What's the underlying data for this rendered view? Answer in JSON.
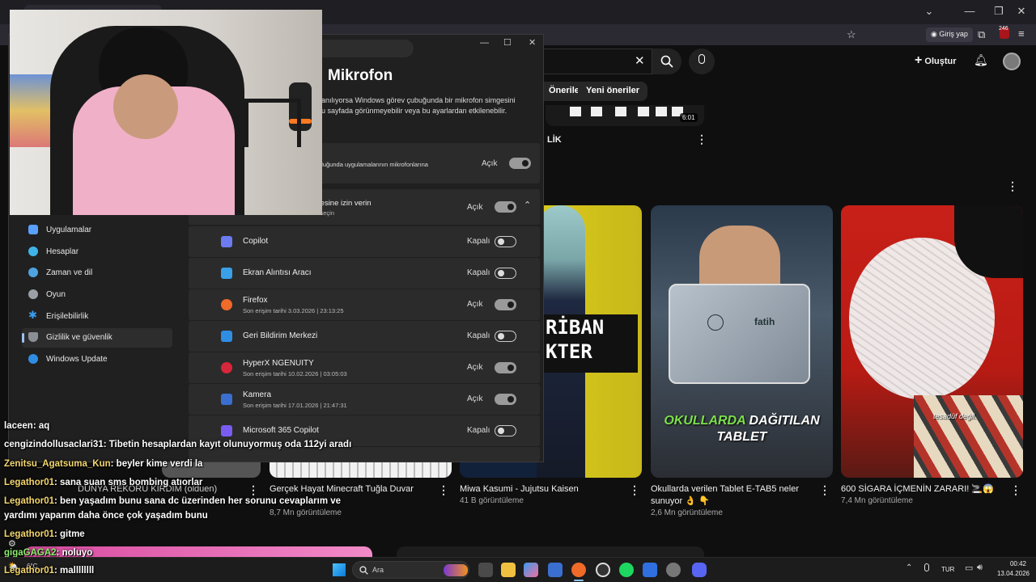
{
  "browser": {
    "signin_label": "Giriş yap",
    "badge_count": "246"
  },
  "youtube": {
    "create_label": "Oluştur",
    "chips": [
      "Önerilen",
      "Yeni öneriler"
    ],
    "first_row": {
      "duration": "6:01",
      "partial_title": "LİK"
    },
    "thumb_overlays": {
      "anime_line1": "RİBAN",
      "anime_line2": "KTER",
      "tablet_line1a": "OKULLARDA",
      "tablet_line1b": "DAĞITILAN",
      "tablet_line2": "TABLET",
      "tablet_brand": "fatih",
      "cig_caption": "tesadüf değil."
    },
    "videos": [
      {
        "title": "DÜNYA REKORU KIRDIM (olduen)",
        "meta": ""
      },
      {
        "title": "Gerçek Hayat Minecraft Tuğla Duvar",
        "meta": "8,7 Mn görüntüleme"
      },
      {
        "title": "Miwa Kasumi - Jujutsu Kaisen",
        "meta": "41 B görüntüleme"
      },
      {
        "title": "Okullarda verilen Tablet E-TAB5 neler sunuyor 👌 👇",
        "meta": "2,6 Mn görüntüleme"
      },
      {
        "title": "600 SİGARA İÇMENİN ZARARI! 🚬😱",
        "meta": "7,4 Mn görüntüleme"
      }
    ]
  },
  "settings": {
    "title": "Mikrofon",
    "description_line1": "anılıyorsa Windows görev çubuğunda bir mikrofon simgesini",
    "description_line2": "u sayfada görünmeyebilir veya bu ayarlardan etkilenebilir.",
    "access_row": {
      "text": "k olduğunda uygulamalarının mikrofonlarına",
      "state": "Açık"
    },
    "apps_row": {
      "text": "şmesine izin verin",
      "sub": "ları seçin",
      "state": "Açık"
    },
    "nav": [
      {
        "label": "Uygulamalar",
        "color": "#5aa0ff"
      },
      {
        "label": "Hesaplar",
        "color": "#3fb3e8"
      },
      {
        "label": "Zaman ve dil",
        "color": "#4fa3e0"
      },
      {
        "label": "Oyun",
        "color": "#9aa0a6"
      },
      {
        "label": "Erişilebilirlik",
        "color": "#3b9cf0"
      },
      {
        "label": "Gizlilik ve güvenlik",
        "color": "#8a8f96"
      },
      {
        "label": "Windows Update",
        "color": "#2f8de4"
      }
    ],
    "apps": [
      {
        "name": "Copilot",
        "sub": "",
        "state": "Kapalı",
        "on": false,
        "color": "#6c7cf0"
      },
      {
        "name": "Ekran Alıntısı Aracı",
        "sub": "",
        "state": "Kapalı",
        "on": false,
        "color": "#3aa0e8"
      },
      {
        "name": "Firefox",
        "sub": "Son erişim tarihi 3.03.2026  |  23:13:25",
        "state": "Açık",
        "on": true,
        "color": "#f06a2a"
      },
      {
        "name": "Geri Bildirim Merkezi",
        "sub": "",
        "state": "Kapalı",
        "on": false,
        "color": "#2f8de4"
      },
      {
        "name": "HyperX NGENUITY",
        "sub": "Son erişim tarihi 10.02.2026  |  03:05:03",
        "state": "Açık",
        "on": true,
        "color": "#d8263a"
      },
      {
        "name": "Kamera",
        "sub": "Son erişim tarihi 17.01.2026  |  21:47:31",
        "state": "Açık",
        "on": true,
        "color": "#3a6fd0"
      },
      {
        "name": "Microsoft 365 Copilot",
        "sub": "",
        "state": "Kapalı",
        "on": false,
        "color": "#7a5cf0"
      }
    ]
  },
  "chat": [
    {
      "user": "laceen",
      "color": "#ffffff",
      "msg": ": aq"
    },
    {
      "user": "cengizindollusaclari31",
      "color": "#ffffff",
      "msg": ": Tibetin hesaplardan kayıt olunuyormuş oda 112yi aradı"
    },
    {
      "user": "Zenitsu_Agatsuma_Kun",
      "color": "#f5d76e",
      "msg": ": beyler kime verdi la"
    },
    {
      "user": "Legathor01",
      "color": "#f5d76e",
      "msg": ": sana suan sms bombing atıorlar"
    },
    {
      "user": "Legathor01",
      "color": "#f5d76e",
      "msg": ": ben yaşadım bunu sana dc üzerinden her sorunu cevaplarım ve"
    },
    {
      "user": "",
      "color": "#ffffff",
      "msg": "yardımı yaparım daha önce çok yaşadım bunu"
    },
    {
      "user": "Legathor01",
      "color": "#f5d76e",
      "msg": ": gitme"
    },
    {
      "user": "gigaGAGA2",
      "color": "#8df06e",
      "msg": ": noluyo"
    },
    {
      "user": "Legathor01",
      "color": "#f5d76e",
      "msg": ": mallllllll"
    }
  ],
  "taskbar": {
    "search_placeholder": "Ara",
    "weather": "6°C",
    "lang": "TUR",
    "time": "00:42",
    "date": "13.04.2026"
  }
}
